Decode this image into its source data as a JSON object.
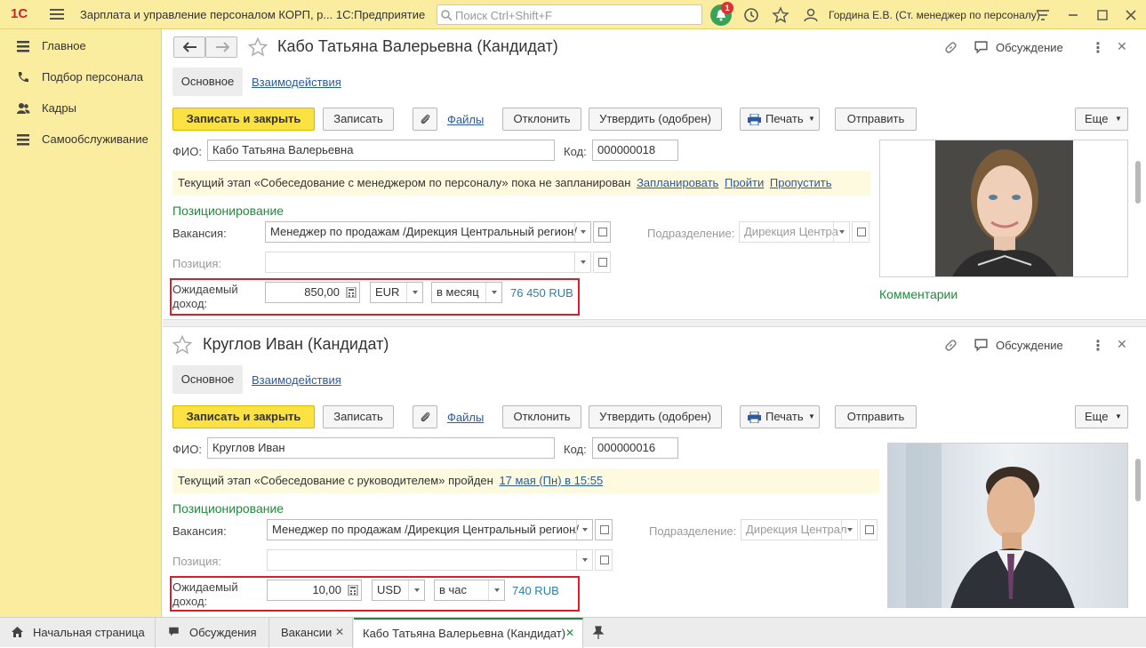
{
  "titlebar": {
    "logo": "1С",
    "app_title": "Зарплата и управление персоналом КОРП, р...  1С:Предприятие",
    "search_placeholder": "Поиск Ctrl+Shift+F",
    "notification_count": "1",
    "user": "Гордина Е.В. (Ст. менеджер по персоналу)"
  },
  "sidebar": {
    "items": [
      {
        "label": "Главное",
        "icon": "menu-lines-icon"
      },
      {
        "label": "Подбор персонала",
        "icon": "phone-icon"
      },
      {
        "label": "Кадры",
        "icon": "people-icon"
      },
      {
        "label": "Самообслуживание",
        "icon": "list-icon"
      }
    ]
  },
  "forms": [
    {
      "title": "Кабо Татьяна Валерьевна (Кандидат)",
      "discussion_label": "Обсуждение",
      "tab_main": "Основное",
      "tab_interactions": "Взаимодействия",
      "btn_save_close": "Записать и закрыть",
      "btn_save": "Записать",
      "files_link": "Файлы",
      "btn_reject": "Отклонить",
      "btn_approve": "Утвердить (одобрен)",
      "btn_print": "Печать",
      "btn_send": "Отправить",
      "btn_more": "Еще",
      "fio_label": "ФИО:",
      "fio_value": "Кабо Татьяна Валерьевна",
      "code_label": "Код:",
      "code_value": "000000018",
      "notice_text": "Текущий этап «Собеседование с менеджером по персоналу» пока не запланирован",
      "notice_links": [
        "Запланировать",
        "Пройти",
        "Пропустить"
      ],
      "section_title": "Позиционирование",
      "vacancy_label": "Вакансия:",
      "vacancy_value": "Менеджер по продажам /Дирекция Центральный регион/",
      "division_label": "Подразделение:",
      "division_value": "Дирекция Центра",
      "position_label": "Позиция:",
      "income_label_1": "Ожидаемый",
      "income_label_2": "доход:",
      "income_value": "850,00",
      "currency": "EUR",
      "period": "в месяц",
      "converted": "76 450 RUB",
      "comments_label": "Комментарии"
    },
    {
      "title": "Круглов Иван (Кандидат)",
      "discussion_label": "Обсуждение",
      "tab_main": "Основное",
      "tab_interactions": "Взаимодействия",
      "btn_save_close": "Записать и закрыть",
      "btn_save": "Записать",
      "files_link": "Файлы",
      "btn_reject": "Отклонить",
      "btn_approve": "Утвердить (одобрен)",
      "btn_print": "Печать",
      "btn_send": "Отправить",
      "btn_more": "Еще",
      "fio_label": "ФИО:",
      "fio_value": "Круглов Иван",
      "code_label": "Код:",
      "code_value": "000000016",
      "notice_text": "Текущий этап «Собеседование с руководителем» пройден",
      "notice_links": [
        "17 мая (Пн) в 15:55"
      ],
      "section_title": "Позиционирование",
      "vacancy_label": "Вакансия:",
      "vacancy_value": "Менеджер по продажам /Дирекция Центральный регион/",
      "division_label": "Подразделение:",
      "division_value": "Дирекция Централ",
      "position_label": "Позиция:",
      "income_label_1": "Ожидаемый",
      "income_label_2": "доход:",
      "income_value": "10,00",
      "currency": "USD",
      "period": "в час",
      "converted": "740 RUB"
    }
  ],
  "bottombar": {
    "tabs": [
      "Начальная страница",
      "Обсуждения",
      "Вакансии",
      "Кабо Татьяна Валерьевна (Кандидат)"
    ]
  },
  "colors": {
    "panel_yellow": "#fbeda0",
    "primary_button": "#fce142",
    "link": "#2a5b9e",
    "section_green": "#1e8c3a",
    "highlight_red": "#d4202a"
  }
}
